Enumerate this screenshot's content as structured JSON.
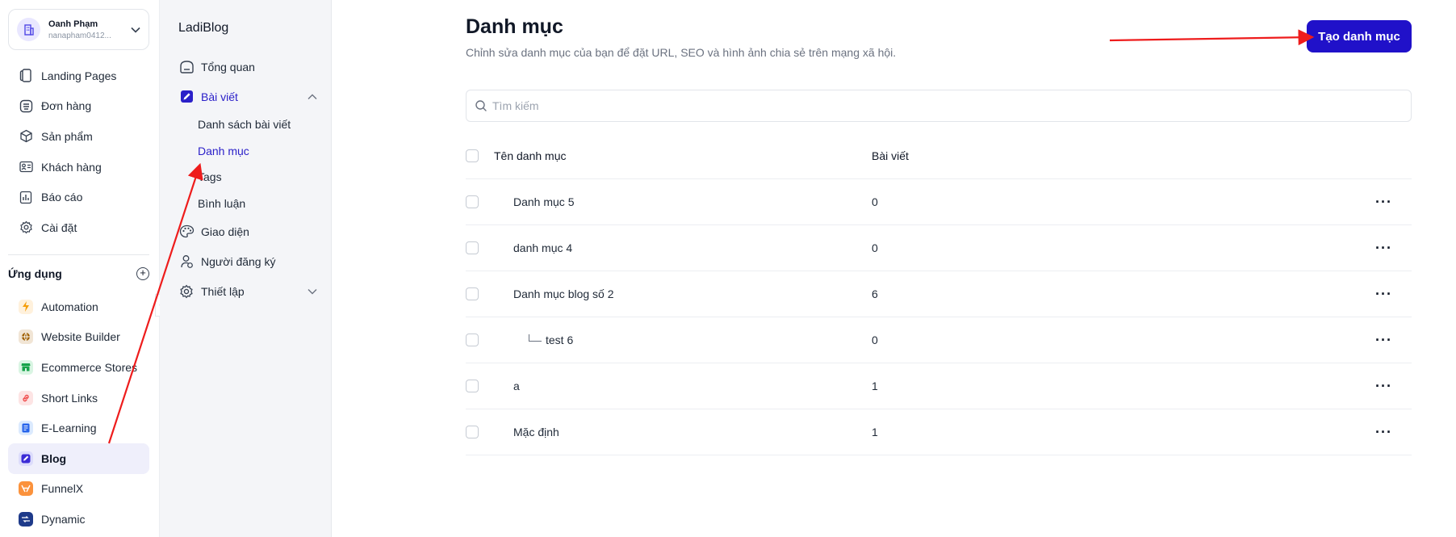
{
  "account": {
    "name": "Oanh Phạm",
    "email": "nanapham0412..."
  },
  "nav": [
    {
      "label": "Landing Pages",
      "icon": "layers-icon"
    },
    {
      "label": "Đơn hàng",
      "icon": "order-icon"
    },
    {
      "label": "Sản phẩm",
      "icon": "box-icon"
    },
    {
      "label": "Khách hàng",
      "icon": "contact-card-icon"
    },
    {
      "label": "Báo cáo",
      "icon": "report-icon"
    },
    {
      "label": "Cài đặt",
      "icon": "gear-icon"
    }
  ],
  "apps_title": "Ứng dụng",
  "apps": [
    {
      "label": "Automation",
      "color": "#f59e0b",
      "bg": "#fff4e0",
      "icon": "lightning-icon"
    },
    {
      "label": "Website Builder",
      "color": "#a16207",
      "bg": "#f3e6d6",
      "icon": "globe-icon"
    },
    {
      "label": "Ecommerce Stores",
      "color": "#16a34a",
      "bg": "#dcfce7",
      "icon": "store-icon"
    },
    {
      "label": "Short Links",
      "color": "#ef4444",
      "bg": "#fde4e4",
      "icon": "link-icon"
    },
    {
      "label": "E-Learning",
      "color": "#2563eb",
      "bg": "#dbeafe",
      "icon": "elearning-icon"
    },
    {
      "label": "Blog",
      "color": "#4338ca",
      "bg": "#e0e7ff",
      "icon": "blog-icon"
    },
    {
      "label": "FunnelX",
      "color": "#f97316",
      "bg": "#ffedd5",
      "icon": "funnel-icon"
    },
    {
      "label": "Dynamic",
      "color": "#1e40af",
      "bg": "#dbeafe",
      "icon": "dynamic-icon"
    }
  ],
  "subbar": {
    "brand": "LadiBlog",
    "items": {
      "overview": "Tổng quan",
      "posts": "Bài viết",
      "post_list": "Danh sách bài viết",
      "categories": "Danh mục",
      "tags": "Tags",
      "comments": "Bình luận",
      "theme": "Giao diện",
      "subscribers": "Người đăng ký",
      "settings": "Thiết lập"
    }
  },
  "main": {
    "title": "Danh mục",
    "subtitle": "Chỉnh sửa danh mục của bạn để đặt URL, SEO và hình ảnh chia sẻ trên mạng xã hội.",
    "create_label": "Tạo danh mục",
    "search_placeholder": "Tìm kiếm",
    "columns": {
      "name": "Tên danh mục",
      "posts": "Bài viết"
    },
    "rows": [
      {
        "name": "Danh mục 5",
        "posts": "0",
        "child": false
      },
      {
        "name": "danh mục 4",
        "posts": "0",
        "child": false
      },
      {
        "name": "Danh mục blog số 2",
        "posts": "6",
        "child": false
      },
      {
        "name": "test 6",
        "posts": "0",
        "child": true
      },
      {
        "name": "a",
        "posts": "1",
        "child": false
      },
      {
        "name": "Mặc định",
        "posts": "1",
        "child": false
      }
    ],
    "more_label": "···"
  },
  "colors": {
    "accent": "#2011c9",
    "annotation": "#ee1c1c"
  }
}
